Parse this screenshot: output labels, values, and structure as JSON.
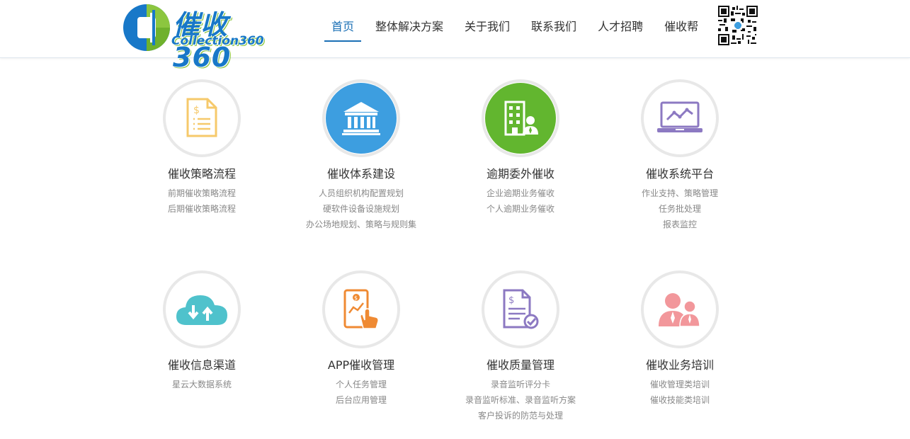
{
  "brand": {
    "logo_cn": "催收360",
    "logo_en": "Collection360"
  },
  "nav": [
    {
      "label": "首页",
      "active": true
    },
    {
      "label": "整体解决方案"
    },
    {
      "label": "关于我们"
    },
    {
      "label": "联系我们"
    },
    {
      "label": "人才招聘"
    },
    {
      "label": "催收帮"
    }
  ],
  "colors": {
    "primary": "#1a6fb5",
    "yellow": "#f6c96b",
    "blue": "#3d9ee0",
    "green": "#62b62f",
    "purple": "#8c79c2",
    "teal": "#4fc2cc",
    "orange": "#ef8a33",
    "pink": "#f2979b"
  },
  "cards": [
    {
      "title": "催收策略流程",
      "icon": "document-dollar-icon",
      "lines": [
        "前期催收策略流程",
        "后期催收策略流程"
      ]
    },
    {
      "title": "催收体系建设",
      "icon": "bank-building-icon",
      "lines": [
        "人员组织机构配置规划",
        "硬软件设备设施规划",
        "办公场地规划、策略与规则集"
      ]
    },
    {
      "title": "逾期委外催收",
      "icon": "office-building-person-icon",
      "lines": [
        "企业逾期业务催收",
        "个人逾期业务催收"
      ]
    },
    {
      "title": "催收系统平台",
      "icon": "laptop-chart-icon",
      "lines": [
        "作业支持、策略管理",
        "任务批处理",
        "报表监控"
      ]
    },
    {
      "title": "催收信息渠道",
      "icon": "cloud-transfer-icon",
      "lines": [
        "星云大数据系统"
      ]
    },
    {
      "title": "APP催收管理",
      "icon": "phone-app-icon",
      "lines": [
        "个人任务管理",
        "后台应用管理"
      ]
    },
    {
      "title": "催收质量管理",
      "icon": "document-check-icon",
      "lines": [
        "录音监听评分卡",
        "录音监听标准、录音监听方案",
        "客户投诉的防范与处理"
      ]
    },
    {
      "title": "催收业务培训",
      "icon": "people-training-icon",
      "lines": [
        "催收管理类培训",
        "催收技能类培训"
      ]
    }
  ]
}
